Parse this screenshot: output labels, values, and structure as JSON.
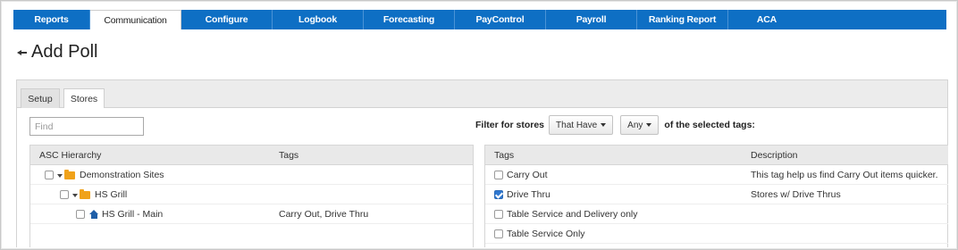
{
  "nav": {
    "tabs": [
      "Reports",
      "Communication",
      "Configure",
      "Logbook",
      "Forecasting",
      "PayControl",
      "Payroll",
      "Ranking Report",
      "ACA"
    ],
    "active_tab": "Communication"
  },
  "page": {
    "title": "Add Poll"
  },
  "subtabs": {
    "items": [
      "Setup",
      "Stores"
    ],
    "active": "Stores"
  },
  "find": {
    "placeholder": "Find",
    "value": ""
  },
  "filter": {
    "label": "Filter for stores",
    "have_option": "That Have",
    "any_option": "Any",
    "tail": "of the selected tags:"
  },
  "hierarchy_table": {
    "headers": [
      "ASC Hierarchy",
      "Tags"
    ],
    "rows": [
      {
        "label": "Demonstration Sites",
        "tags": "",
        "icon": "folder-icon",
        "checked": false
      },
      {
        "label": "HS Grill",
        "tags": "",
        "icon": "folder-icon",
        "checked": false
      },
      {
        "label": "HS Grill - Main",
        "tags": "Carry Out, Drive Thru",
        "icon": "home-icon",
        "checked": false
      }
    ]
  },
  "tags_table": {
    "headers": [
      "Tags",
      "Description"
    ],
    "rows": [
      {
        "tag": "Carry Out",
        "description": "This tag help us find Carry Out items quicker.",
        "checked": false
      },
      {
        "tag": "Drive Thru",
        "description": "Stores w/ Drive Thrus",
        "checked": true
      },
      {
        "tag": "Table Service and Delivery only",
        "description": "",
        "checked": false
      },
      {
        "tag": "Table Service Only",
        "description": "",
        "checked": false
      }
    ]
  },
  "colors": {
    "nav_blue": "#0e6fc4",
    "folder": "#f0a21a",
    "home": "#1f5fa8",
    "checkbox_checked": "#2f78d1"
  }
}
